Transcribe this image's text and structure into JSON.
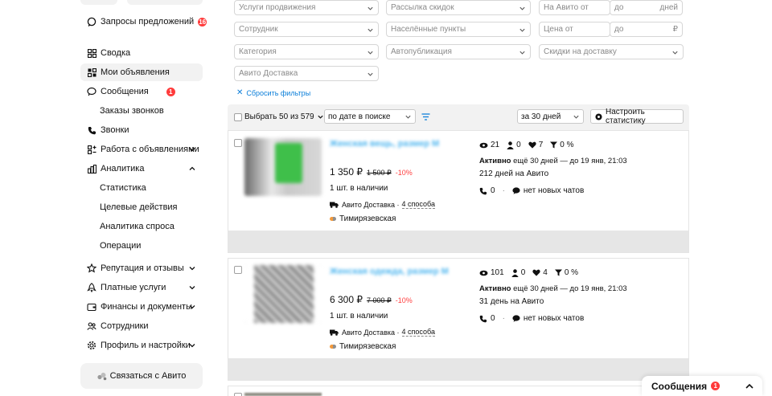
{
  "sidebar": {
    "requests": {
      "label": "Запросы предложений",
      "badge": "16"
    },
    "items": [
      {
        "label": "Сводка"
      },
      {
        "label": "Мои объявления"
      },
      {
        "label": "Сообщения",
        "badge": "1"
      },
      {
        "label": "Заказы звонков"
      },
      {
        "label": "Звонки"
      },
      {
        "label": "Работа с объявлениями"
      },
      {
        "label": "Аналитика"
      },
      {
        "label": "Статистика"
      },
      {
        "label": "Целевые действия"
      },
      {
        "label": "Аналитика спроса"
      },
      {
        "label": "Операции"
      },
      {
        "label": "Репутация и отзывы"
      },
      {
        "label": "Платные услуги"
      },
      {
        "label": "Финансы и документы"
      },
      {
        "label": "Сотрудники"
      },
      {
        "label": "Профиль и настройки"
      }
    ],
    "contact_button": "Связаться с Авито"
  },
  "filters": {
    "promotion_services": "Услуги продвижения",
    "discount_mailing": "Рассылка скидок",
    "on_avito_from": "На Авито от",
    "to_label": "до",
    "days_suffix": "дней",
    "employee": "Сотрудник",
    "settlements": "Населённые пункты",
    "price_from": "Цена от",
    "price_to": "до",
    "currency": "₽",
    "category": "Категория",
    "autopublish": "Автопубликация",
    "delivery_discounts": "Скидки на доставку",
    "avito_delivery": "Авито Доставка",
    "reset": "Сбросить фильтры"
  },
  "toolbar": {
    "select_label": "Выбрать 50 из 579",
    "sort": "по дате в поиске",
    "period": "за 30 дней",
    "configure": "Настроить статистику"
  },
  "listings": [
    {
      "title": "Женская вещь, размер M",
      "price": "1 350 ₽",
      "old_price": "1 500 ₽",
      "discount": "-10%",
      "stock": "1 шт. в наличии",
      "delivery": "Авито Доставка ·",
      "delivery_link": "4 способа",
      "metro": "Тимирязевская",
      "views": "21",
      "contacts": "0",
      "favorites": "7",
      "conversion": "0 %",
      "status_bold": "Активно",
      "status_rest": " ещё 30 дней — до 19 янв, 21:03",
      "days_on_avito": "212 дней на Авито",
      "calls": "0",
      "chats": "нет новых чатов",
      "thumb_color": "#3fbf4a"
    },
    {
      "title": "Женская одежда, размер M",
      "price": "6 300 ₽",
      "old_price": "7 000 ₽",
      "discount": "-10%",
      "stock": "1 шт. в наличии",
      "delivery": "Авито Доставка ·",
      "delivery_link": "4 способа",
      "metro": "Тимирязевская",
      "views": "101",
      "contacts": "0",
      "favorites": "4",
      "conversion": "0 %",
      "status_bold": "Активно",
      "status_rest": " ещё 30 дней — до 19 янв, 21:03",
      "days_on_avito": "31 день на Авито",
      "calls": "0",
      "chats": "нет новых чатов",
      "thumb_color": "#8a8a8a"
    }
  ],
  "messenger": {
    "label": "Сообщения",
    "badge": "1"
  },
  "colors": {
    "accent_link": "#0a7ed9",
    "badge_red": "#ff3b3b",
    "title_blue": "#4fb6ef"
  }
}
